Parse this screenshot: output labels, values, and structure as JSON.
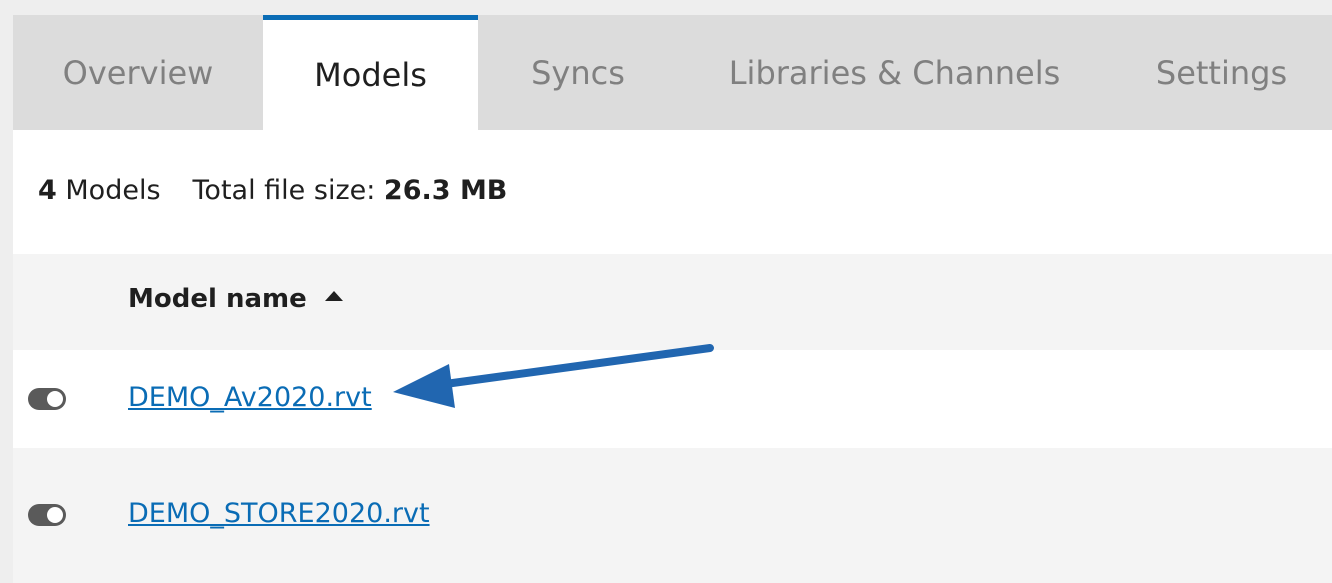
{
  "tabs": [
    {
      "label": "Overview"
    },
    {
      "label": "Models",
      "active": true
    },
    {
      "label": "Syncs"
    },
    {
      "label": "Libraries & Channels"
    },
    {
      "label": "Settings"
    }
  ],
  "summary": {
    "model_count": "4",
    "models_label": "Models",
    "size_label": "Total file size:",
    "size_value": "26.3 MB"
  },
  "table": {
    "column_header": "Model name",
    "sort_direction": "ascending",
    "rows": [
      {
        "name": "DEMO_Av2020.rvt",
        "toggle_on": true
      },
      {
        "name": "DEMO_STORE2020.rvt",
        "toggle_on": true
      }
    ]
  },
  "colors": {
    "accent": "#0a6cb5",
    "annotation_arrow": "#2166b0",
    "tab_bar": "#dcdcdc",
    "toggle": "#5a5a5a"
  },
  "annotation": {
    "type": "arrow",
    "target": "DEMO_Av2020.rvt"
  }
}
